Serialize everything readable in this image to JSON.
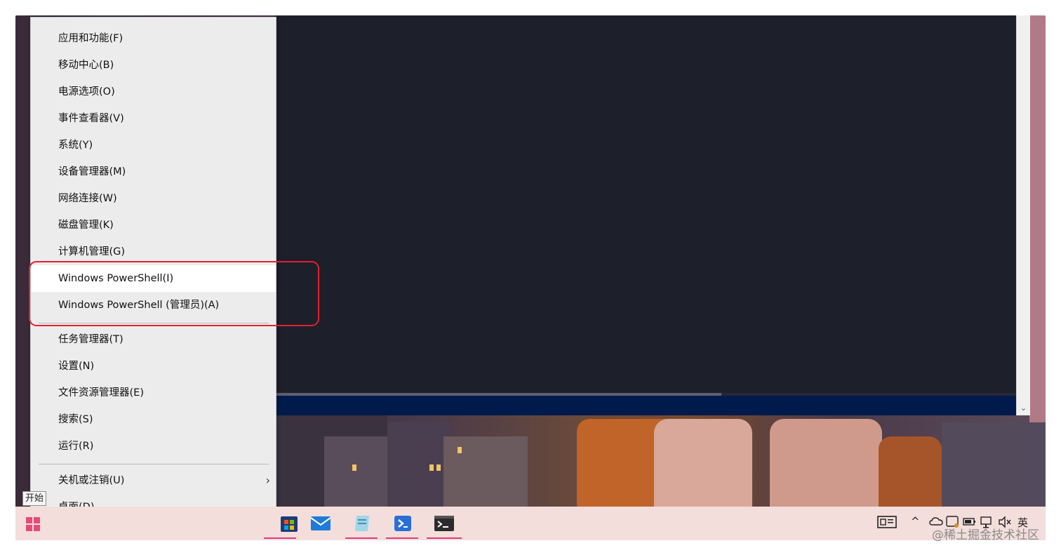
{
  "menu": {
    "items": [
      {
        "label": "应用和功能(F)"
      },
      {
        "label": "移动中心(B)"
      },
      {
        "label": "电源选项(O)"
      },
      {
        "label": "事件查看器(V)"
      },
      {
        "label": "系统(Y)"
      },
      {
        "label": "设备管理器(M)"
      },
      {
        "label": "网络连接(W)"
      },
      {
        "label": "磁盘管理(K)"
      },
      {
        "label": "计算机管理(G)"
      },
      {
        "label": "Windows PowerShell(I)"
      },
      {
        "label": "Windows PowerShell (管理员)(A)"
      },
      {
        "label": "任务管理器(T)"
      },
      {
        "label": "设置(N)"
      },
      {
        "label": "文件资源管理器(E)"
      },
      {
        "label": "搜索(S)"
      },
      {
        "label": "运行(R)"
      },
      {
        "label": "关机或注销(U)"
      },
      {
        "label": "桌面(D)"
      }
    ],
    "submenu_arrow": "›"
  },
  "tooltip": {
    "text": "开始"
  },
  "taskbar": {
    "icons": [
      "start-icon",
      "search-icon",
      "task-view-icon",
      "widgets-icon",
      "edge-icon",
      "explorer-icon",
      "store-icon",
      "mail-icon",
      "notepad-icon",
      "powershell-icon",
      "terminal-icon"
    ]
  },
  "tray": {
    "chevron": "^",
    "ime": "英"
  },
  "watermark": {
    "text": "@稀土掘金技术社区"
  },
  "colors": {
    "highlight_box": "#e5202e",
    "taskbar_indicator": "#e5397a",
    "terminal_bg": "#1d1f2b"
  }
}
